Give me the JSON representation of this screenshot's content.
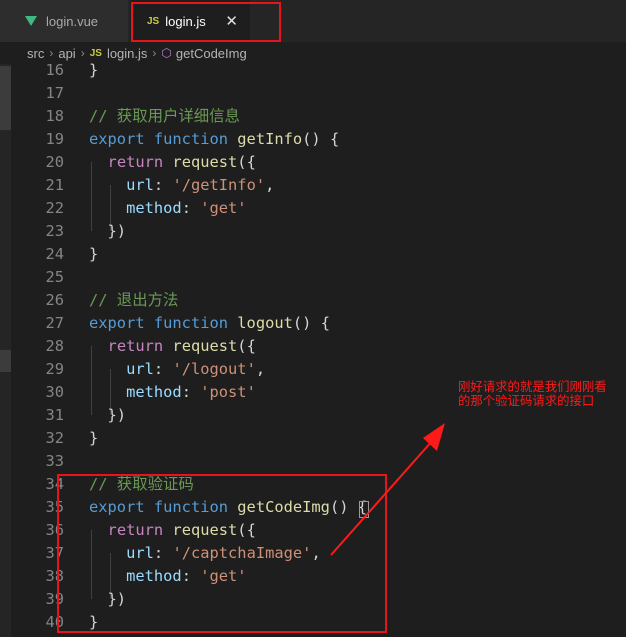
{
  "tabs": [
    {
      "label": "login.vue",
      "icon": "vue-icon",
      "active": false
    },
    {
      "label": "login.js",
      "icon": "js-icon",
      "active": true,
      "icon_text": "JS",
      "close": "✕"
    }
  ],
  "breadcrumb": {
    "parts": [
      "src",
      "api",
      "login.js",
      "getCodeImg"
    ],
    "js_badge": "JS",
    "sep": "›"
  },
  "code_lines": [
    {
      "n": "16",
      "seg": [
        [
          "p",
          "}"
        ]
      ]
    },
    {
      "n": "17",
      "seg": []
    },
    {
      "n": "18",
      "seg": [
        [
          "c",
          "// 获取用户详细信息"
        ]
      ]
    },
    {
      "n": "19",
      "seg": [
        [
          "k",
          "export "
        ],
        [
          "k",
          "function "
        ],
        [
          "f",
          "getInfo"
        ],
        [
          "p",
          "() {"
        ]
      ]
    },
    {
      "n": "20",
      "seg": [
        [
          "p",
          "  "
        ],
        [
          "ctl",
          "return "
        ],
        [
          "f",
          "request"
        ],
        [
          "p",
          "({"
        ]
      ]
    },
    {
      "n": "21",
      "seg": [
        [
          "p",
          "    "
        ],
        [
          "pr",
          "url"
        ],
        [
          "p",
          ": "
        ],
        [
          "s",
          "'/getInfo'"
        ],
        [
          "p",
          ","
        ]
      ]
    },
    {
      "n": "22",
      "seg": [
        [
          "p",
          "    "
        ],
        [
          "pr",
          "method"
        ],
        [
          "p",
          ": "
        ],
        [
          "s",
          "'get'"
        ]
      ]
    },
    {
      "n": "23",
      "seg": [
        [
          "p",
          "  })"
        ]
      ]
    },
    {
      "n": "24",
      "seg": [
        [
          "p",
          "}"
        ]
      ]
    },
    {
      "n": "25",
      "seg": []
    },
    {
      "n": "26",
      "seg": [
        [
          "c",
          "// 退出方法"
        ]
      ]
    },
    {
      "n": "27",
      "seg": [
        [
          "k",
          "export "
        ],
        [
          "k",
          "function "
        ],
        [
          "f",
          "logout"
        ],
        [
          "p",
          "() {"
        ]
      ]
    },
    {
      "n": "28",
      "seg": [
        [
          "p",
          "  "
        ],
        [
          "ctl",
          "return "
        ],
        [
          "f",
          "request"
        ],
        [
          "p",
          "({"
        ]
      ]
    },
    {
      "n": "29",
      "seg": [
        [
          "p",
          "    "
        ],
        [
          "pr",
          "url"
        ],
        [
          "p",
          ": "
        ],
        [
          "s",
          "'/logout'"
        ],
        [
          "p",
          ","
        ]
      ]
    },
    {
      "n": "30",
      "seg": [
        [
          "p",
          "    "
        ],
        [
          "pr",
          "method"
        ],
        [
          "p",
          ": "
        ],
        [
          "s",
          "'post'"
        ]
      ]
    },
    {
      "n": "31",
      "seg": [
        [
          "p",
          "  })"
        ]
      ]
    },
    {
      "n": "32",
      "seg": [
        [
          "p",
          "}"
        ]
      ]
    },
    {
      "n": "33",
      "seg": []
    },
    {
      "n": "34",
      "seg": [
        [
          "c",
          "// 获取验证码"
        ]
      ]
    },
    {
      "n": "35",
      "seg": [
        [
          "k",
          "export "
        ],
        [
          "k",
          "function "
        ],
        [
          "f",
          "getCodeImg"
        ],
        [
          "p",
          "() {"
        ]
      ]
    },
    {
      "n": "36",
      "seg": [
        [
          "p",
          "  "
        ],
        [
          "ctl",
          "return "
        ],
        [
          "f",
          "request"
        ],
        [
          "p",
          "({"
        ]
      ]
    },
    {
      "n": "37",
      "seg": [
        [
          "p",
          "    "
        ],
        [
          "pr",
          "url"
        ],
        [
          "p",
          ": "
        ],
        [
          "s",
          "'/captchaImage'"
        ],
        [
          "p",
          ","
        ]
      ]
    },
    {
      "n": "38",
      "seg": [
        [
          "p",
          "    "
        ],
        [
          "pr",
          "method"
        ],
        [
          "p",
          ": "
        ],
        [
          "s",
          "'get'"
        ]
      ]
    },
    {
      "n": "39",
      "seg": [
        [
          "p",
          "  })"
        ]
      ]
    },
    {
      "n": "40",
      "seg": [
        [
          "p",
          "}"
        ]
      ]
    }
  ],
  "annotation": {
    "text": "刚好请求的就是我们刚刚看的那个验证码请求的接口",
    "color": "#ff1a1a"
  },
  "colors": {
    "highlight_box": "#e8141b",
    "editor_bg": "#1e1e1e"
  }
}
